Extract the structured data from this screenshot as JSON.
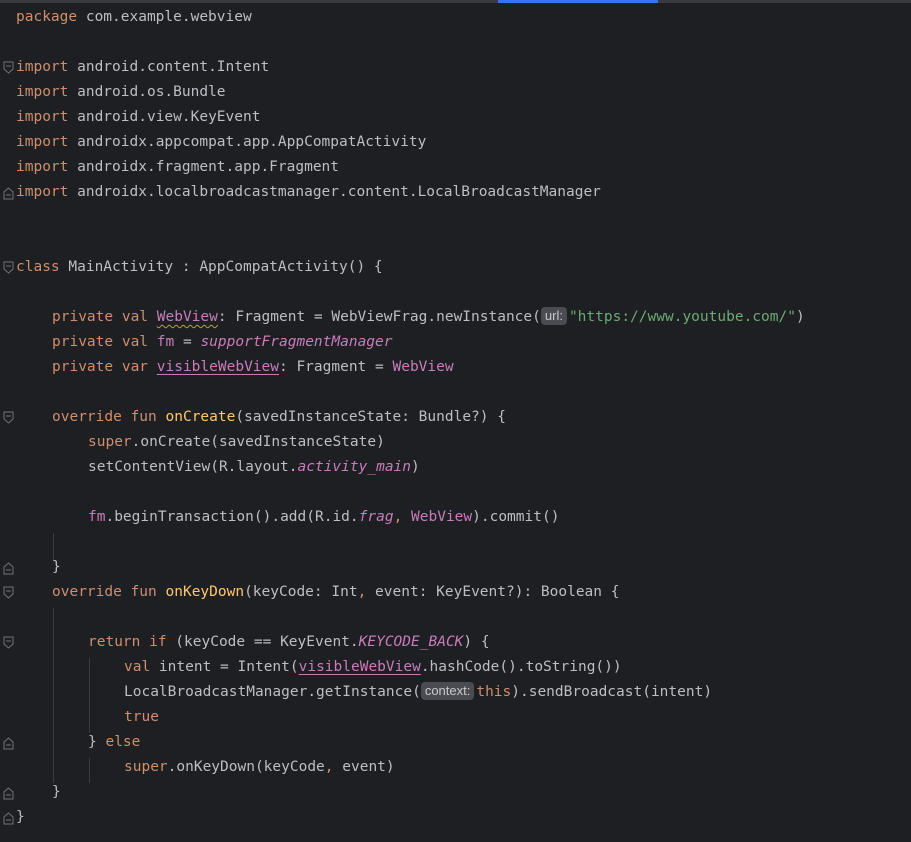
{
  "line_package": {
    "kw": "package",
    "rest": " com.example.webview"
  },
  "imports": {
    "kw": "import",
    "i1": " android.content.Intent",
    "i2": " android.os.Bundle",
    "i3": " android.view.KeyEvent",
    "i4": " androidx.appcompat.app.AppCompatActivity",
    "i5": " androidx.fragment.app.Fragment",
    "i6": " androidx.localbroadcastmanager.content.LocalBroadcastManager"
  },
  "class_decl": {
    "kw": "class",
    "rest": " MainActivity : AppCompatActivity() {"
  },
  "p1": {
    "mod": "private val ",
    "name": "WebView",
    "type": ": Fragment = WebViewFrag.newInstance(",
    "hint": "url:",
    "str": "\"https://www.youtube.com/\"",
    "end": ")"
  },
  "p2": {
    "mod": "private val ",
    "name": "fm",
    "eq": " = ",
    "val": "supportFragmentManager"
  },
  "p3": {
    "mod": "private var ",
    "name": "visibleWebView",
    "type": ": Fragment = ",
    "val": "WebView"
  },
  "oc": {
    "mod": "override fun ",
    "name": "onCreate",
    "params": "(savedInstanceState: Bundle?) {"
  },
  "oc1": {
    "kw": "super",
    "rest": ".onCreate(savedInstanceState)"
  },
  "oc2": {
    "pre": "setContentView(R.layout.",
    "ital": "activity_main",
    "end": ")"
  },
  "oc3": {
    "fm": "fm",
    "mid": ".beginTransaction().add(R.id.",
    "ital": "frag",
    "comma": ", ",
    "wv": "WebView",
    "end": ").commit()"
  },
  "close1": "}",
  "okd": {
    "mod": "override fun ",
    "name": "onKeyDown",
    "params1": "(keyCode: Int",
    "comma": ", ",
    "params2": "event: KeyEvent?): Boolean {"
  },
  "ret": {
    "kw": "return if",
    "pre": " (keyCode == KeyEvent.",
    "ital": "KEYCODE_BACK",
    "end": ") {"
  },
  "r1": {
    "kw": "val",
    "pre": " intent = Intent(",
    "ul": "visibleWebView",
    "end": ".hashCode().toString())"
  },
  "r2": {
    "pre": "LocalBroadcastManager.getInstance(",
    "hint": "context:",
    "kw": "this",
    "end": ").sendBroadcast(intent)"
  },
  "r3": {
    "kw": "true"
  },
  "els": {
    "pre": "} ",
    "kw": "else"
  },
  "e1": {
    "kw": "super",
    "pre": ".onKeyDown(keyCode",
    "comma": ", ",
    "end": "event)"
  },
  "close2": "}",
  "close3": "}"
}
